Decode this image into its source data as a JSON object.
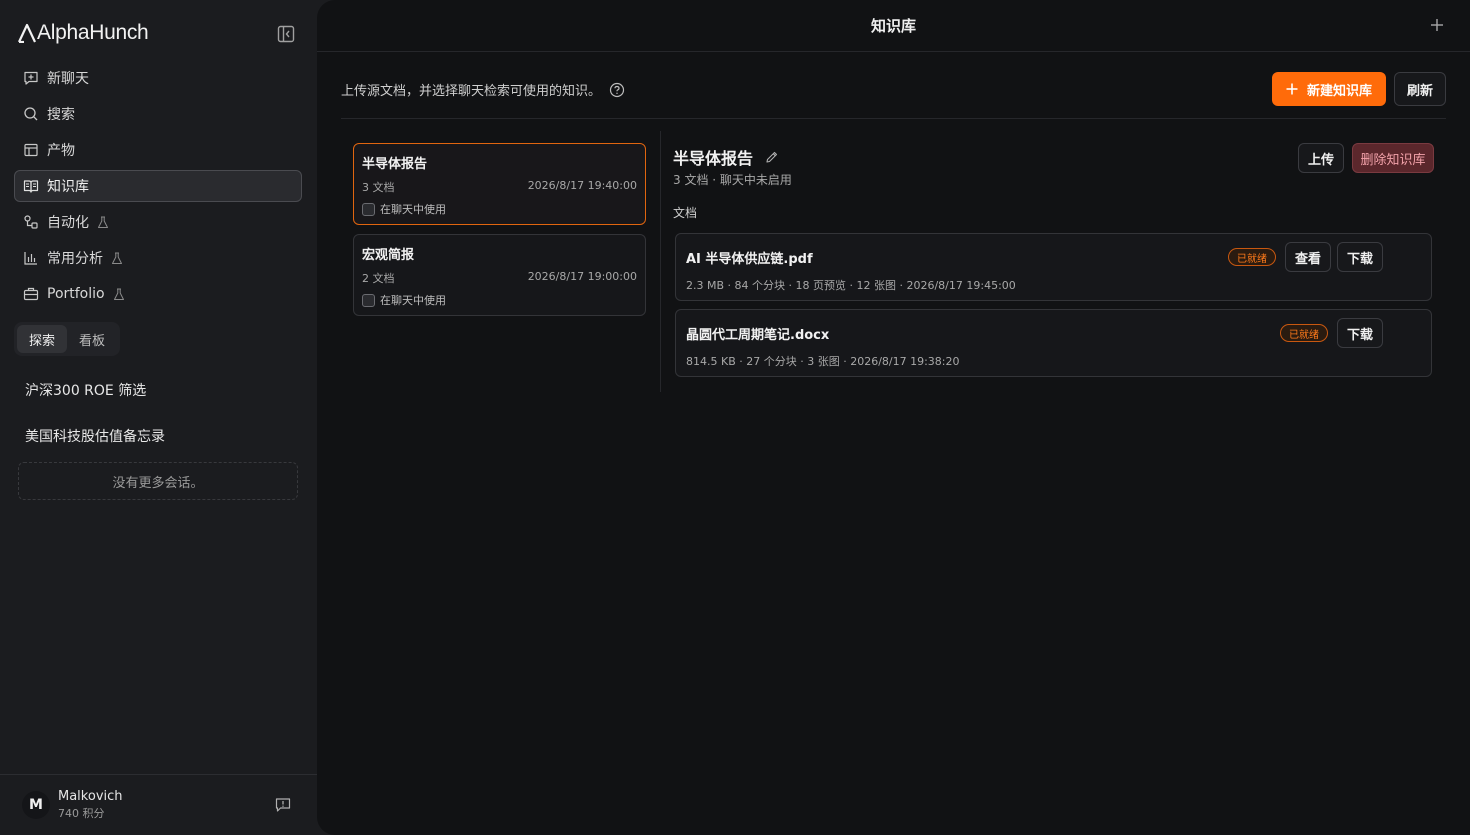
{
  "brand": {
    "name": "AlphaHunch"
  },
  "sidebar": {
    "nav": [
      {
        "label": "新聊天",
        "icon": "new-chat-icon"
      },
      {
        "label": "搜索",
        "icon": "search-icon"
      },
      {
        "label": "产物",
        "icon": "artifacts-icon"
      },
      {
        "label": "知识库",
        "icon": "book-open-icon",
        "active": true
      },
      {
        "label": "自动化",
        "icon": "automation-icon",
        "beta": true
      },
      {
        "label": "常用分析",
        "icon": "bar-chart-icon",
        "beta": true
      },
      {
        "label": "Portfolio",
        "icon": "briefcase-icon",
        "beta": true
      }
    ],
    "tabs": [
      {
        "label": "探索",
        "active": true
      },
      {
        "label": "看板",
        "active": false
      }
    ],
    "conversations": [
      "沪深300 ROE 筛选",
      "美国科技股估值备忘录"
    ],
    "no_more": "没有更多会话。",
    "user": {
      "initial": "M",
      "name": "Malkovich",
      "points": "740 积分"
    }
  },
  "main": {
    "title": "知识库",
    "intro": "上传源文档，并选择聊天检索可使用的知识。",
    "new_kb_label": "新建知识库",
    "refresh_label": "刷新",
    "knowledge_bases": [
      {
        "name": "半导体报告",
        "count": "3 文档",
        "date": "2026/8/17 19:40:00",
        "use_in_chat": "在聊天中使用",
        "selected": true
      },
      {
        "name": "宏观简报",
        "count": "2 文档",
        "date": "2026/8/17 19:00:00",
        "use_in_chat": "在聊天中使用",
        "selected": false
      }
    ],
    "detail": {
      "title": "半导体报告",
      "meta": "3 文档 · 聊天中未启用",
      "upload_label": "上传",
      "delete_label": "删除知识库",
      "docs_label": "文档",
      "documents": [
        {
          "name": "AI 半导体供应链.pdf",
          "status": "已就绪",
          "meta": "2.3 MB · 84 个分块 · 18 页预览 · 12 张图 · 2026/8/17 19:45:00",
          "view_label": "查看",
          "download_label": "下载"
        },
        {
          "name": "晶圆代工周期笔记.docx",
          "status": "已就绪",
          "meta": "814.5 KB · 27 个分块 · 3 张图 · 2026/8/17 19:38:20",
          "download_label": "下载"
        }
      ]
    }
  },
  "colors": {
    "accent": "#ff6b0a",
    "danger_bg": "#5b272c",
    "danger_text": "#f3a2aa"
  }
}
